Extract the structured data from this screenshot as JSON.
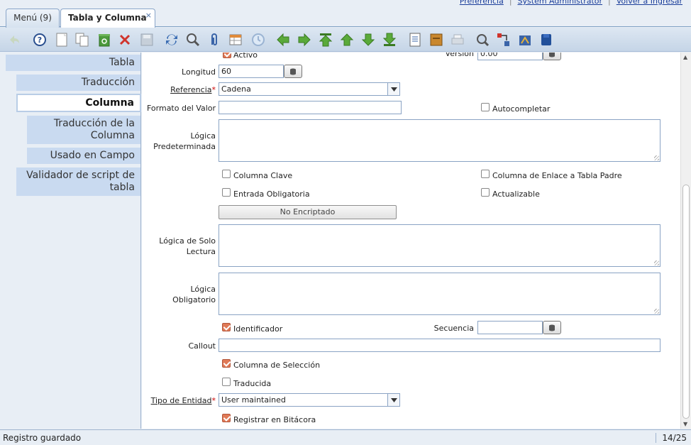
{
  "top_links": [
    "Preferencia",
    "System Administrator",
    "Volver a Ingresar"
  ],
  "tabs": [
    {
      "label": "Menú (9)"
    },
    {
      "label": "Tabla y Columna",
      "close": "×"
    }
  ],
  "toolbar": {
    "buttons": [
      "undo-icon",
      "help-icon",
      "new-record-icon",
      "copy-record-icon",
      "save-recycle-icon",
      "delete-icon",
      "save-icon",
      "refresh-icon",
      "find-icon",
      "attachment-icon",
      "grid-toggle-icon",
      "history-icon",
      "previous-tab-icon",
      "next-tab-icon",
      "first-record-icon",
      "previous-record-icon",
      "next-record-icon",
      "last-record-icon",
      "report-icon",
      "archive-icon",
      "print-icon",
      "zoom-across-icon",
      "workflow-icon",
      "process-icon",
      "exit-icon"
    ]
  },
  "nav": {
    "items": [
      {
        "label": "Tabla"
      },
      {
        "label": "Traducción"
      },
      {
        "label": "Columna"
      },
      {
        "label": "Traducción de la Columna"
      },
      {
        "label": "Usado en Campo"
      },
      {
        "label": "Validador de script de tabla"
      }
    ]
  },
  "form": {
    "activo_label": "Activo",
    "activo": true,
    "version_label": "Version",
    "version_value": "0.00",
    "longitud_label": "Longitud",
    "longitud_value": "60",
    "referencia_label": "Referencia",
    "referencia_value": "Cadena",
    "formato_label": "Formato del Valor",
    "formato_value": "",
    "autocompletar_label": "Autocompletar",
    "autocompletar": false,
    "logica_pred_label_1": "Lógica",
    "logica_pred_label_2": "Predeterminada",
    "columna_clave_label": "Columna Clave",
    "columna_clave": false,
    "columna_enlace_label": "Columna de Enlace a Tabla Padre",
    "columna_enlace": false,
    "entrada_oblig_label": "Entrada Obligatoria",
    "entrada_oblig": false,
    "actualizable_label": "Actualizable",
    "actualizable": false,
    "encriptado_button": "No Encriptado",
    "logica_solo_lectura_label_1": "Lógica de Solo",
    "logica_solo_lectura_label_2": "Lectura",
    "logica_oblig_label_1": "Lógica",
    "logica_oblig_label_2": "Obligatorio",
    "identificador_label": "Identificador",
    "identificador": true,
    "secuencia_label": "Secuencia",
    "secuencia_value": "",
    "callout_label": "Callout",
    "callout_value": "",
    "columna_seleccion_label": "Columna de Selección",
    "columna_seleccion": true,
    "traducida_label": "Traducida",
    "traducida": false,
    "tipo_entidad_label": "Tipo de Entidad",
    "tipo_entidad_value": "User maintained",
    "registrar_bitacora_label": "Registrar en Bitácora",
    "registrar_bitacora": true,
    "required_mark": "*"
  },
  "status": {
    "message": "Registro guardado",
    "record": "14/25"
  }
}
